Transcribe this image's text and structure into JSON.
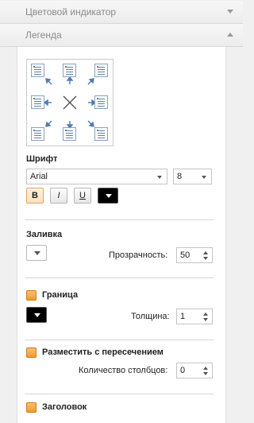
{
  "sections": {
    "color_indicator": "Цветовой индикатор",
    "legend": "Легенда"
  },
  "font": {
    "label": "Шрифт",
    "family": "Arial",
    "size": "8",
    "bold": "B",
    "italic": "I",
    "underline": "U"
  },
  "fill": {
    "label": "Заливка",
    "transparency_label": "Прозрачность:",
    "transparency_value": "50"
  },
  "border": {
    "label": "Граница",
    "thickness_label": "Толщина:",
    "thickness_value": "1"
  },
  "overlap": {
    "label": "Разместить с пересечением",
    "columns_label": "Количество столбцов:",
    "columns_value": "0"
  },
  "heading": {
    "label": "Заголовок"
  },
  "colors": {
    "accent_checkbox": "#f5a440",
    "font_color": "#000000",
    "border_color": "#000000",
    "fill_color": "#ffffff"
  }
}
